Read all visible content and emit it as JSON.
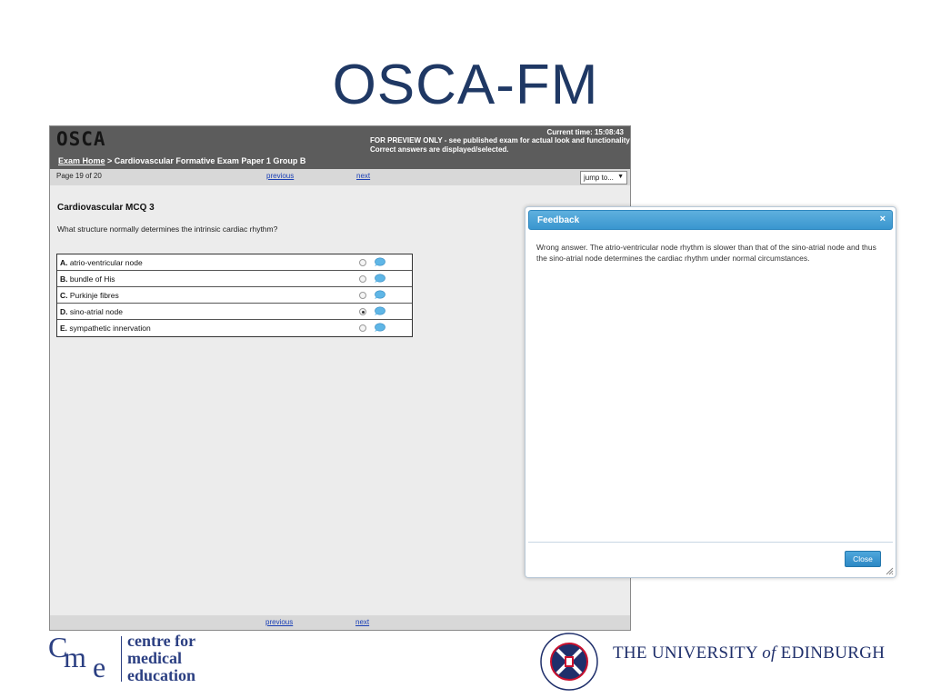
{
  "slide": {
    "title": "OSCA-FM"
  },
  "app": {
    "logo": "OSCA",
    "clock": "Current time: 15:08:43",
    "preview_note": "FOR PREVIEW ONLY - see published exam for actual look and functionality Correct answers are displayed/selected.",
    "breadcrumb": {
      "home": "Exam Home",
      "path": "> Cardiovascular Formative Exam Paper 1 Group B"
    },
    "nav": {
      "page": "Page 19 of 20",
      "previous": "previous",
      "next": "next",
      "jump_value": "jump to..."
    },
    "question": {
      "title": "Cardiovascular MCQ 3",
      "text": "What structure normally determines the intrinsic cardiac rhythm?",
      "answers": [
        {
          "letter": "A.",
          "text": "atrio-ventricular node",
          "selected": false
        },
        {
          "letter": "B.",
          "text": "bundle of His",
          "selected": false
        },
        {
          "letter": "C.",
          "text": "Purkinje fibres",
          "selected": false
        },
        {
          "letter": "D.",
          "text": "sino-atrial node",
          "selected": true
        },
        {
          "letter": "E.",
          "text": "sympathetic innervation",
          "selected": false
        }
      ]
    },
    "footer_nav": {
      "previous": "previous",
      "next": "next"
    }
  },
  "feedback": {
    "title": "Feedback",
    "close_x": "×",
    "body": "Wrong answer. The atrio-ventricular node rhythm is slower than that of the sino-atrial node and thus the sino-atrial node determines the cardiac rhythm under normal circumstances.",
    "close_label": "Close"
  },
  "logos": {
    "cme": {
      "c": "C",
      "m": "m",
      "e": "e",
      "line1": "centre for",
      "line2": "medical",
      "line3": "education"
    },
    "uoe": {
      "name_pre": "THE UNIVERSITY ",
      "name_of": "of",
      "name_post": " EDINBURGH"
    }
  },
  "colors": {
    "title": "#1f3864",
    "header": "#5c5c5c",
    "dialog_accent": "#3996cf",
    "link": "#1a3fb5"
  }
}
